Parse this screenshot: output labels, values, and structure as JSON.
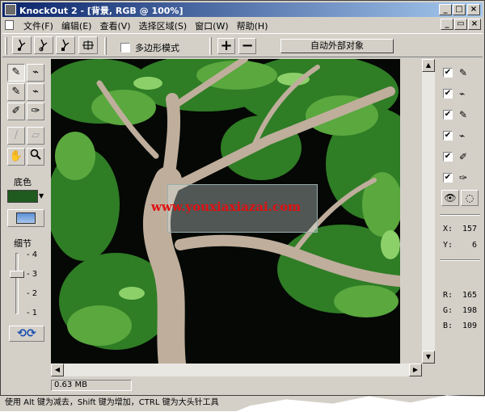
{
  "window": {
    "title": "KnockOut 2 - [背景, RGB @ 100%]",
    "controls": [
      "_",
      "□",
      "×"
    ]
  },
  "menu": {
    "items": [
      "文件(F)",
      "编辑(E)",
      "查看(V)",
      "选择区域(S)",
      "窗口(W)",
      "帮助(H)"
    ],
    "doc_controls": [
      "_",
      "▭",
      "×"
    ]
  },
  "toolbar": {
    "tools": [
      "inside-object-tool",
      "outside-object-tool",
      "edge-tool",
      "crop-tool"
    ],
    "polygon_mode_label": "多边形模式",
    "polygon_mode_checked": false,
    "plus_label": "+",
    "minus_label": "−",
    "auto_outside_label": "自动外部对象"
  },
  "left_panel": {
    "background_color_label": "底色",
    "background_color": "#1f5a1f",
    "detail_label": "细节",
    "detail_ticks": [
      "4",
      "3",
      "2",
      "1"
    ],
    "detail_level": 3
  },
  "canvas": {
    "watermark": "www.youxiaxiazai.com"
  },
  "right_panel": {
    "layer_checks": [
      true,
      true,
      true,
      true,
      true,
      true
    ],
    "x_label": "X:",
    "x_value": "157",
    "y_label": "Y:",
    "y_value": "6",
    "r_label": "R:",
    "r_value": "165",
    "g_label": "G:",
    "g_value": "198",
    "b_label": "B:",
    "b_value": "109"
  },
  "status": {
    "file_size": "0.63 MB",
    "hint": "使用 Alt 键为减去，Shift 键为增加，CTRL 键为大头针工具"
  }
}
